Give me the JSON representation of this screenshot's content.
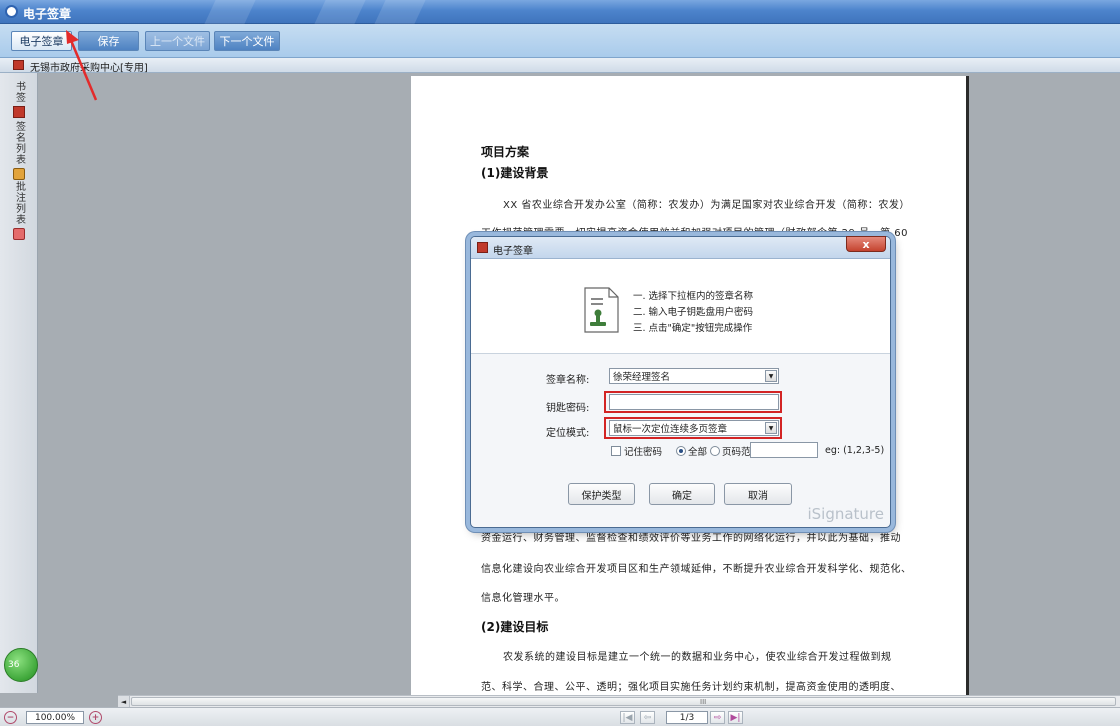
{
  "window": {
    "title": "电子签章"
  },
  "toolbar": {
    "sign_label": "电子签章",
    "save_label": "保存",
    "prev_file_label": "上一个文件",
    "next_file_label": "下一个文件"
  },
  "doc_tab": {
    "label": "无锡市政府采购中心[专用]"
  },
  "sidebar": {
    "items": [
      {
        "label": "书签",
        "icon": "book-icon"
      },
      {
        "label": "签名列表",
        "icon": "lock-icon"
      },
      {
        "label": "批注列表",
        "icon": "comment-icon"
      }
    ],
    "badge": "36"
  },
  "document": {
    "heading1": "项目方案",
    "heading2": "(1)建设背景",
    "p1": "XX 省农业综合开发办公室（简称：农发办）为满足国家对农业综合开发（简称：农发）",
    "p2": "工作规范管理需要，切实提高资金使用效益和加强对项目的管理（财政部令第 29 号，第 60",
    "p3": "资金运行、财务管理、监督检查和绩效评价等业务工作的网络化运行，并以此为基础，推动",
    "p4": "信息化建设向农业综合开发项目区和生产领域延伸，不断提升农业综合开发科学化、规范化、",
    "p5": "信息化管理水平。",
    "heading3": "(2)建设目标",
    "p6": "农发系统的建设目标是建立一个统一的数据和业务中心，使农业综合开发过程做到规",
    "p7": "范、科学、合理、公平、透明；强化项目实施任务计划约束机制，提高资金使用的透明度、"
  },
  "dialog": {
    "title": "电子签章",
    "close_label": "x",
    "steps": [
      "一. 选择下拉框内的签章名称",
      "二. 输入电子钥匙盘用户密码",
      "三. 点击\"确定\"按钮完成操作"
    ],
    "seal_name_label": "签章名称:",
    "seal_name_value": "徐荣经理签名",
    "key_password_label": "钥匙密码:",
    "key_password_value": "",
    "position_mode_label": "定位模式:",
    "position_mode_value": "鼠标一次定位连续多页签章",
    "remember_password_label": "记住密码",
    "all_label": "全部",
    "page_range_label": "页码范围",
    "page_range_value": "",
    "eg_text": "eg: (1,2,3-5)",
    "protect_type_label": "保护类型",
    "ok_label": "确定",
    "cancel_label": "取消",
    "watermark": "iSignature"
  },
  "statusbar": {
    "zoom": "100.00%",
    "page": "1/3",
    "scroll_grip": "III",
    "scroll_left": "◄"
  },
  "colors": {
    "accent_red": "#d32424",
    "title_blue": "#4d84cc"
  }
}
